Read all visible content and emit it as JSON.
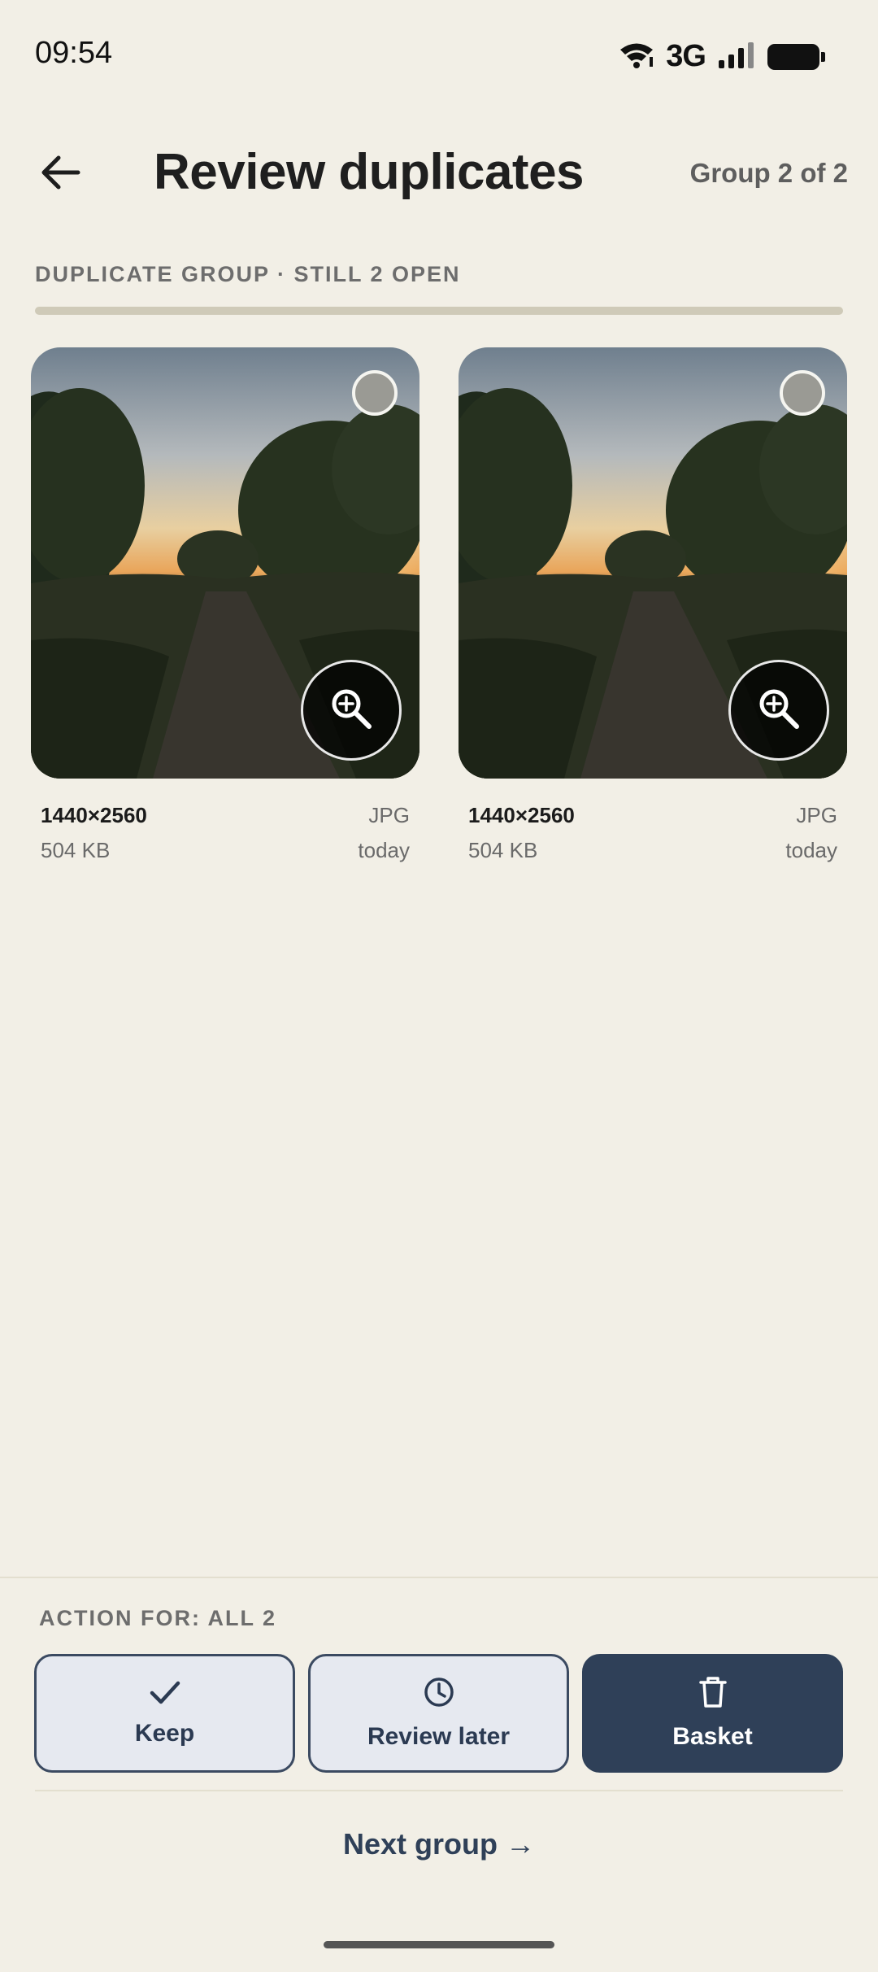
{
  "status_bar": {
    "time": "09:54",
    "network": "3G"
  },
  "header": {
    "title": "Review duplicates",
    "group_counter": "Group 2 of 2"
  },
  "section": {
    "label": "DUPLICATE GROUP · STILL 2 OPEN"
  },
  "photos": [
    {
      "dimensions": "1440×2560",
      "format": "JPG",
      "size": "504 KB",
      "date": "today",
      "selected": false
    },
    {
      "dimensions": "1440×2560",
      "format": "JPG",
      "size": "504 KB",
      "date": "today",
      "selected": false
    }
  ],
  "actions": {
    "label": "ACTION FOR: ALL 2",
    "keep": "Keep",
    "review_later": "Review later",
    "basket": "Basket"
  },
  "footer": {
    "next_group": "Next group →"
  },
  "colors": {
    "background": "#f2efe6",
    "accent": "#2f4058",
    "button_outline_bg": "#e6e9f0"
  }
}
